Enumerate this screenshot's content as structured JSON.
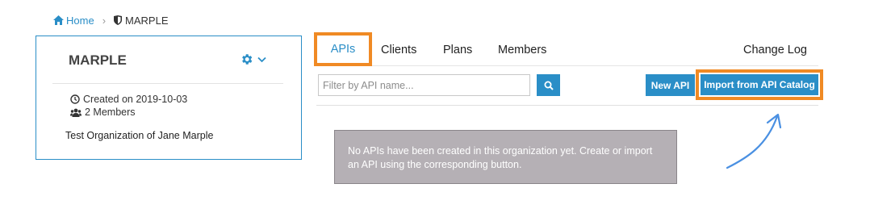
{
  "breadcrumb": {
    "home": "Home",
    "separator": "›",
    "current": "MARPLE"
  },
  "org": {
    "name": "MARPLE",
    "created": "Created on 2019-10-03",
    "members": "2 Members",
    "description": "Test Organization of Jane Marple"
  },
  "tabs": [
    "APIs",
    "Clients",
    "Plans",
    "Members"
  ],
  "change_log": "Change Log",
  "filter": {
    "placeholder": "Filter by API name..."
  },
  "buttons": {
    "new_api": "New API",
    "import": "Import from API Catalog"
  },
  "empty_message": "No APIs have been created in this organization yet. Create or import an API using the corresponding button.",
  "colors": {
    "accent": "#2a8ec7",
    "highlight": "#f08a24",
    "message_bg": "#b5b0b5"
  },
  "icons": [
    "home-icon",
    "shield-icon",
    "gear-icon",
    "chevron-down-icon",
    "clock-icon",
    "users-icon",
    "search-icon",
    "arrow-icon"
  ]
}
